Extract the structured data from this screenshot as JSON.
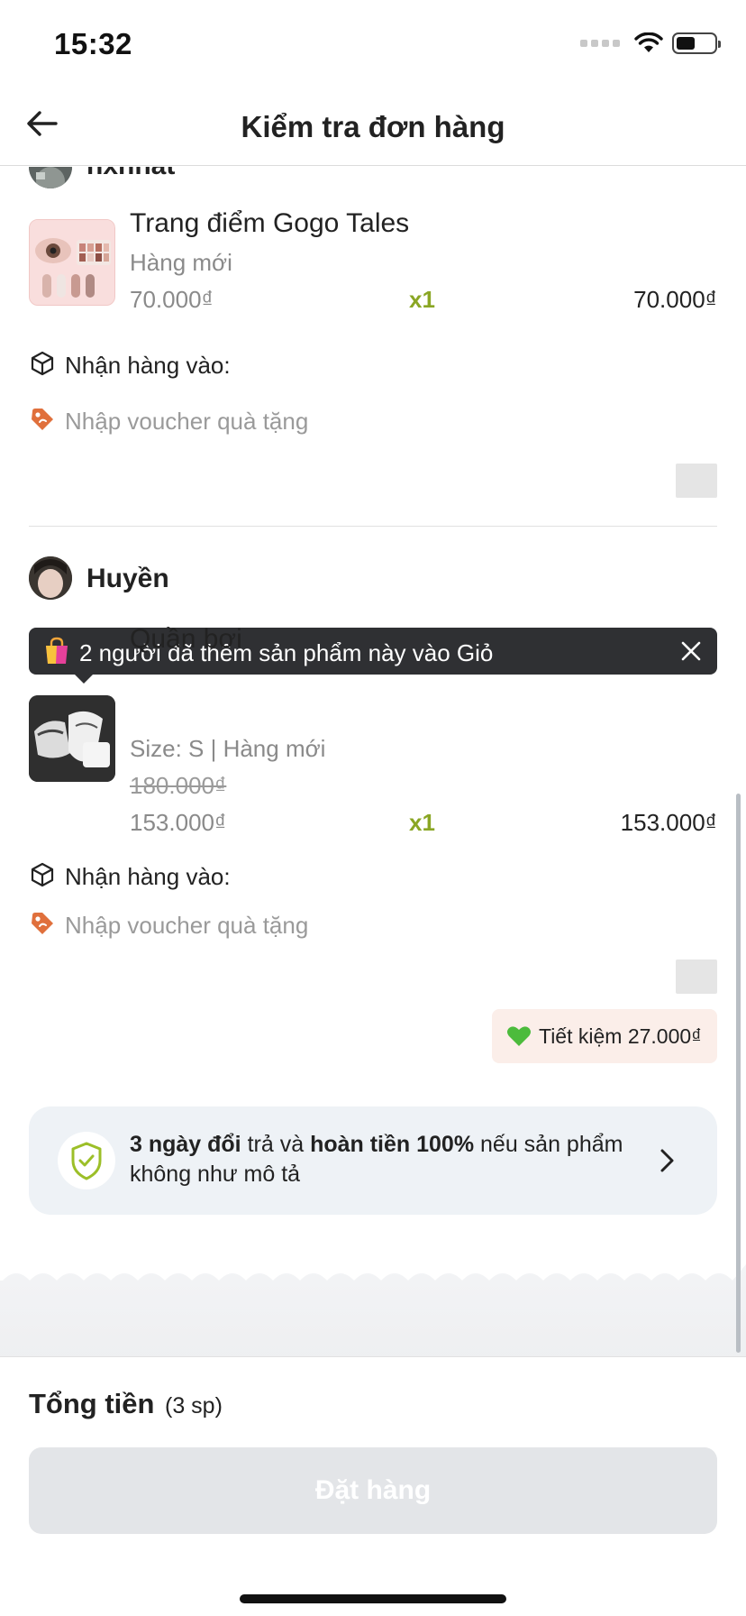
{
  "status_bar": {
    "time": "15:32"
  },
  "header": {
    "title": "Kiểm tra đơn hàng"
  },
  "shops": [
    {
      "seller": "nxnhat",
      "product": {
        "name": "Trang điểm Gogo Tales",
        "variant": "Hàng mới",
        "price": "70.000₫",
        "qty": "x1",
        "total": "70.000₫"
      },
      "delivery_label": "Nhận hàng vào:",
      "voucher_placeholder": "Nhập voucher quà tặng"
    },
    {
      "seller": "Huyền",
      "toast": "2 người đã thêm sản phẩm này vào Giỏ",
      "product": {
        "name": "Quần bơi",
        "variant": "Size: S  |  Hàng mới",
        "old_price": "180.000₫",
        "price": "153.000₫",
        "qty": "x1",
        "total": "153.000₫"
      },
      "delivery_label": "Nhận hàng vào:",
      "voucher_placeholder": "Nhập voucher quà tặng",
      "saving": "Tiết kiệm 27.000₫"
    }
  ],
  "guarantee": {
    "bold1": "3 ngày đổi",
    "text1": " trả và ",
    "bold2": "hoàn tiền 100%",
    "text2": " nếu sản phẩm không như mô tả"
  },
  "footer": {
    "total_label": "Tổng tiền",
    "total_count": "(3 sp)",
    "order_button": "Đặt hàng"
  },
  "colors": {
    "qty_green": "#8aa624",
    "voucher_orange": "#e0703c",
    "toast_bg": "#2f3033",
    "saving_bg": "#fbeee9",
    "guarantee_bg": "#eef2f6",
    "button_disabled": "#e3e5e8"
  },
  "icons": [
    "back-arrow-icon",
    "wifi-icon",
    "battery-icon",
    "box-icon",
    "tag-icon",
    "shopping-bag-icon",
    "close-icon",
    "green-heart-icon",
    "shield-check-icon",
    "chevron-right-icon"
  ]
}
